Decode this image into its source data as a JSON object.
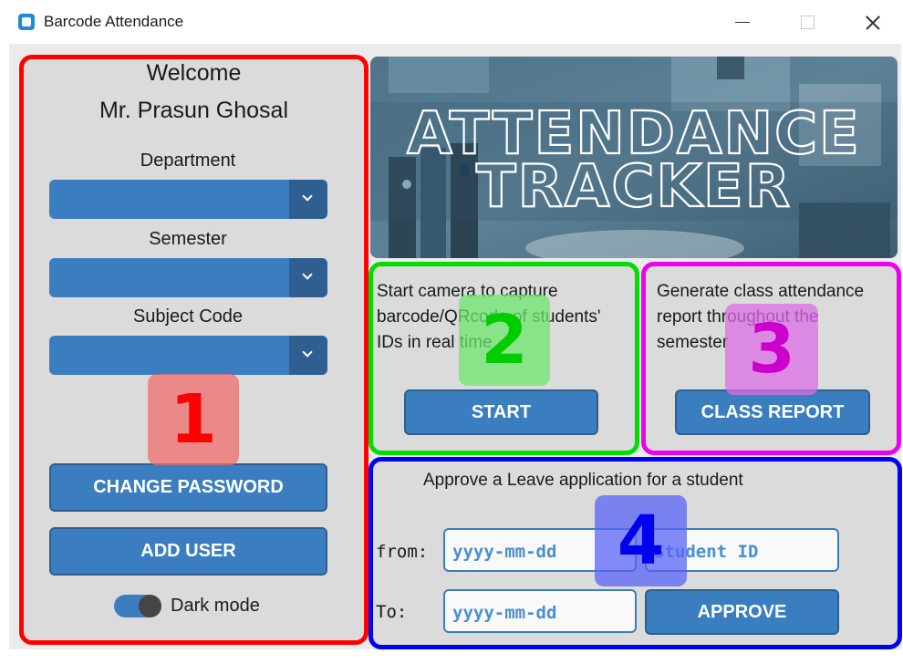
{
  "window": {
    "title": "Barcode Attendance"
  },
  "sidebar": {
    "welcome_line": "Welcome",
    "user_name": "Mr. Prasun Ghosal",
    "department_label": "Department",
    "semester_label": "Semester",
    "subject_label": "Subject Code",
    "change_password": "CHANGE PASSWORD",
    "add_user": "ADD USER",
    "dark_mode_label": "Dark mode"
  },
  "banner": {
    "line1": "ATTENDANCE",
    "line2": "TRACKER"
  },
  "capture": {
    "line1": "Start camera to capture",
    "line2": "barcode/QRcode of students'",
    "line3": "IDs in real time",
    "button": "START"
  },
  "report": {
    "line1": "Generate class attendance",
    "line2": "report throughout the",
    "line3": "semester",
    "button": "CLASS REPORT"
  },
  "leave": {
    "title": "Approve a Leave application for a student",
    "from_label": "from:",
    "to_label": "To:",
    "from_placeholder": "yyyy-mm-dd",
    "student_placeholder": "Student ID",
    "to_placeholder": "yyyy-mm-dd",
    "approve": "APPROVE"
  },
  "annotations": {
    "n1": "1",
    "n2": "2",
    "n3": "3",
    "n4": "4"
  },
  "colors": {
    "accent": "#3a7ebf",
    "outline_1": "#ff0000",
    "outline_2": "#00dd00",
    "outline_3": "#ee00ee",
    "outline_4": "#0000ee"
  }
}
